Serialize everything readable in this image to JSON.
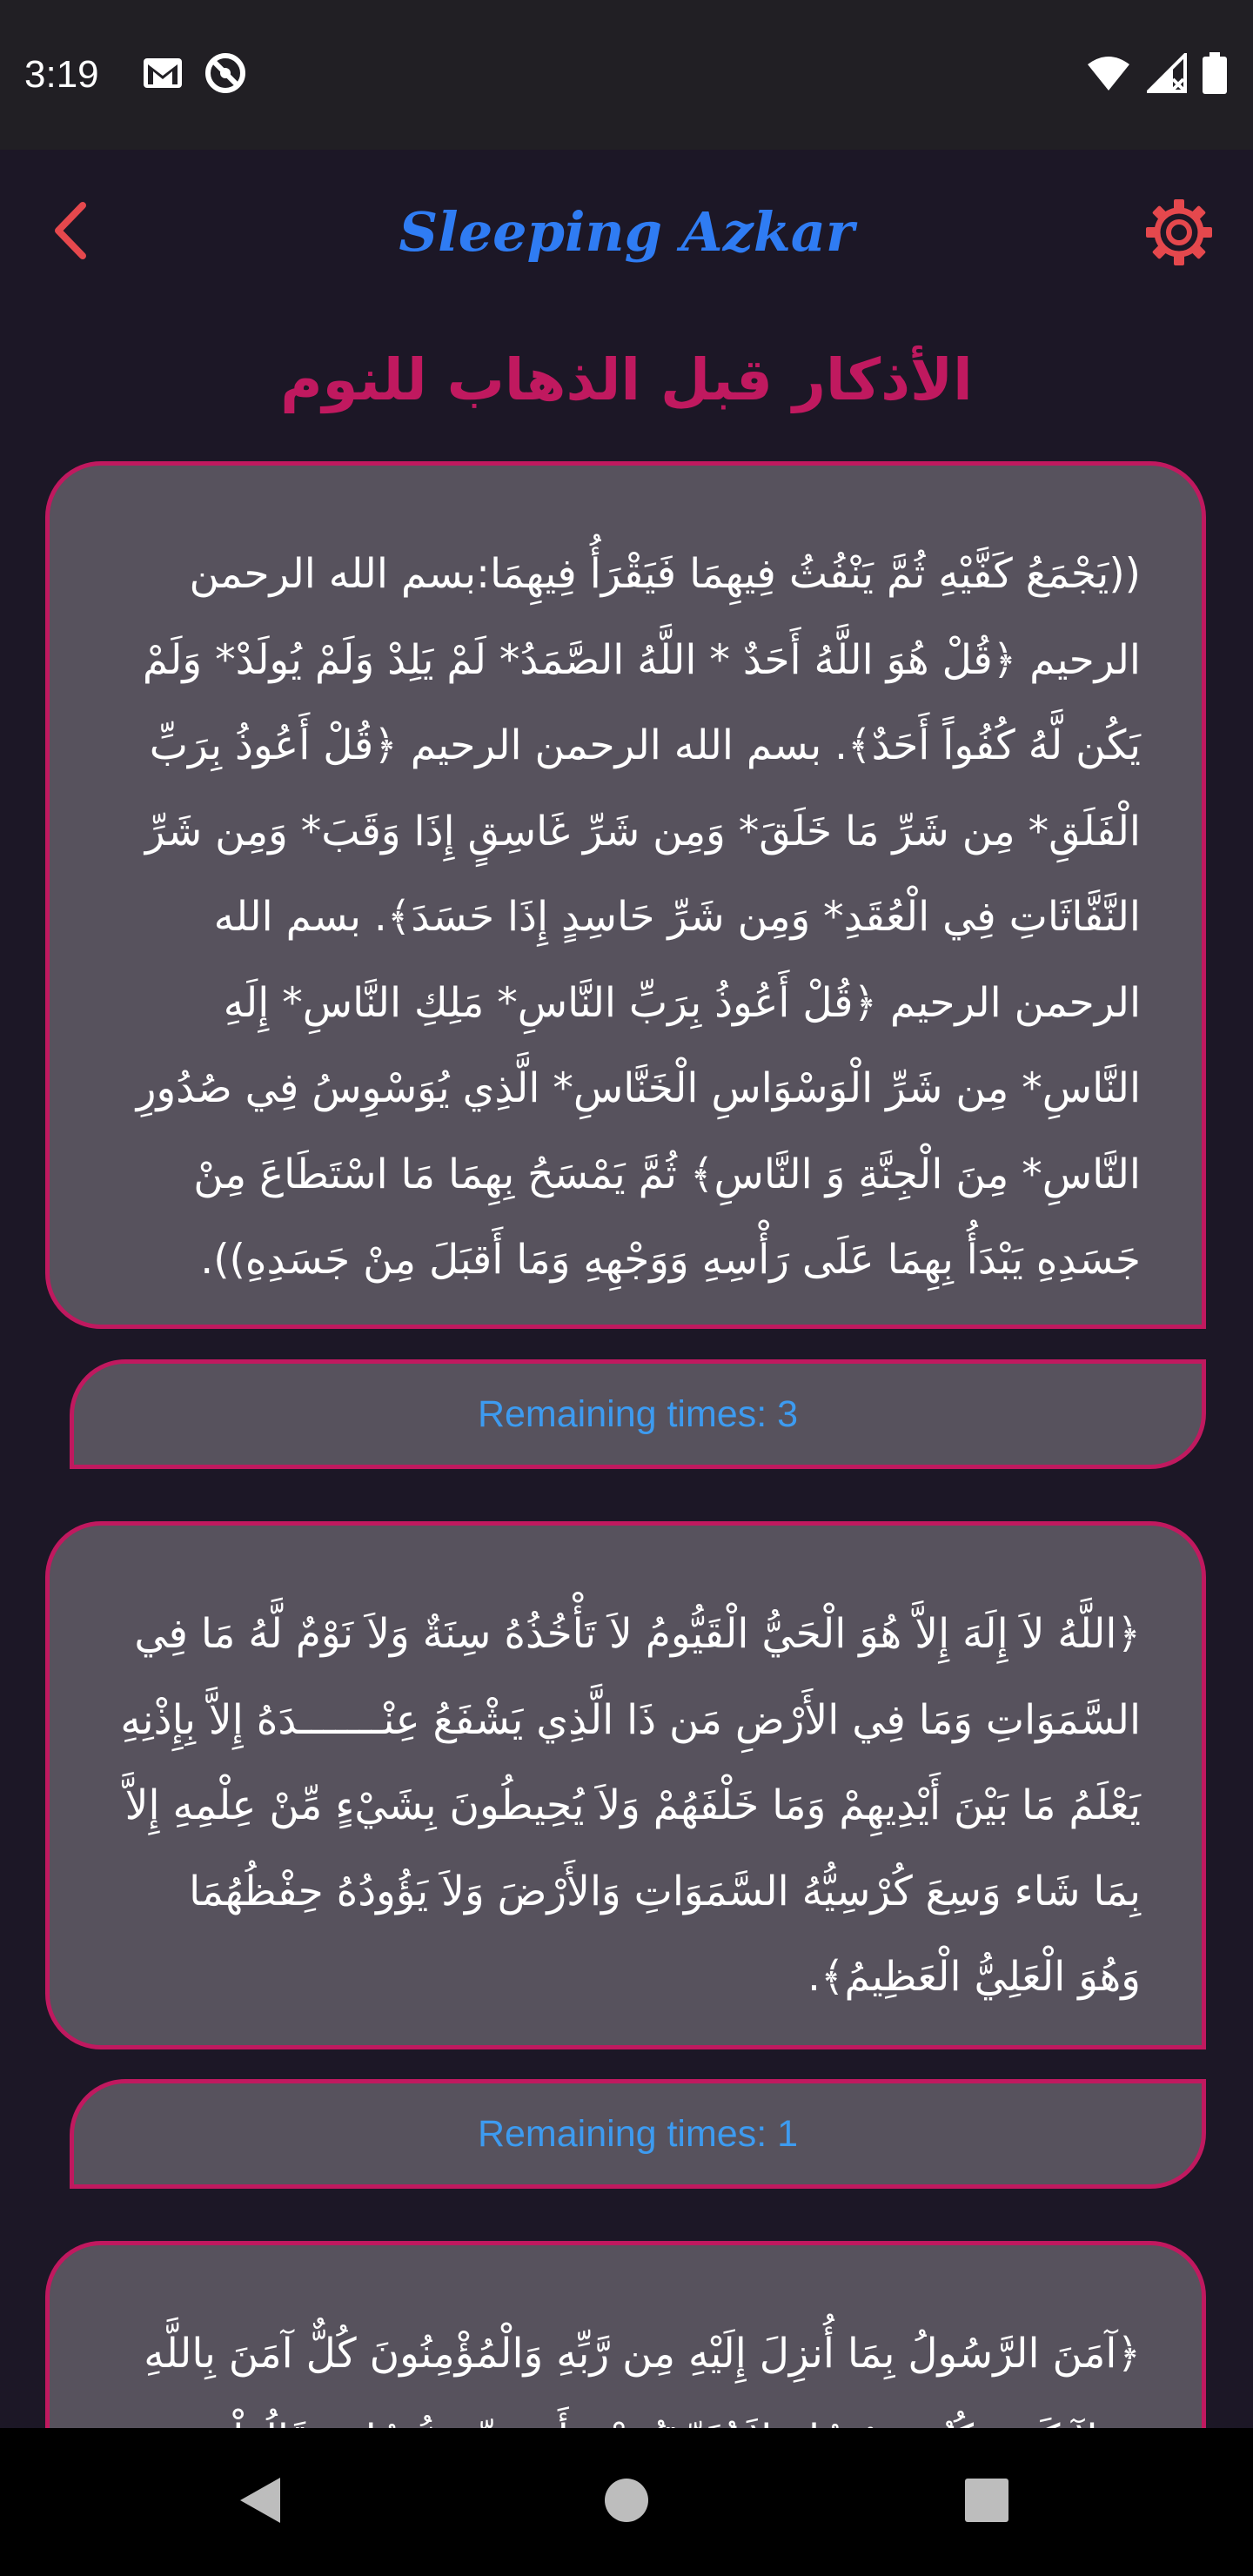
{
  "status_bar": {
    "time": "3:19",
    "icons": [
      "gmail-icon",
      "do-not-disturb-icon",
      "wifi-icon",
      "signal-icon",
      "battery-icon"
    ]
  },
  "app_bar": {
    "title": "Sleeping Azkar",
    "back_icon": "chevron-left-icon",
    "settings_icon": "gear-icon"
  },
  "page": {
    "heading": "الأذكار قبل الذهاب للنوم"
  },
  "azkar": [
    {
      "text": "((يَجْمَعُ كَفَّيْهِ ثُمَّ يَنْفُثُ فِيهِمَا فَيَقْرَأُ فِيهِمَا:بسم الله الرحمن الرحيم ﴿قُلْ هُوَ اللَّهُ أَحَدٌ * اللَّهُ الصَّمَدُ* لَمْ يَلِدْ وَلَمْ يُولَدْ* وَلَمْ يَكُن لَّهُ كُفُواً أَحَدٌ﴾. بسم الله الرحمن الرحيم ﴿قُلْ أَعُوذُ بِرَبِّ الْفَلَقِ* مِن شَرِّ مَا خَلَقَ* وَمِن شَرِّ غَاسِقٍ إِذَا وَقَبَ* وَمِن شَرِّ النَّفَّاثَاتِ فِي الْعُقَدِ* وَمِن شَرِّ حَاسِدٍ إِذَا حَسَدَ﴾. بسم الله الرحمن الرحيم ﴿قُلْ أَعُوذُ بِرَبِّ النَّاسِ* مَلِكِ النَّاسِ* إِلَهِ النَّاسِ* مِن شَرِّ الْوَسْوَاسِ الْخَنَّاسِ* الَّذِي يُوَسْوِسُ فِي صُدُورِ النَّاسِ* مِنَ الْجِنَّةِ وَ النَّاسِ﴾ ثُمَّ يَمْسَحُ بِهِمَا مَا اسْتَطَاعَ مِنْ جَسَدِهِ يَبْدَأُ بِهِمَا عَلَى رَأْسِهِ وَوَجْهِهِ وَمَا أَقبَلَ مِنْ جَسَدِهِ)).",
      "remaining_label": "Remaining times: 3"
    },
    {
      "text": "﴿اللَّهُ لاَ إِلَهَ إِلاَّ هُوَ الْحَيُّ الْقَيُّومُ لاَ تَأْخُذُهُ سِنَةٌ وَلاَ نَوْمٌ لَّهُ مَا فِي السَّمَوَاتِ وَمَا فِي الأَرْضِ مَن ذَا الَّذِي يَشْفَعُ عِنْـــــــدَهُ إِلاَّ بِإِذْنِهِ يَعْلَمُ مَا بَيْنَ أَيْدِيهِمْ وَمَا خَلْفَهُمْ وَلاَ يُحِيطُونَ بِشَيْءٍ مِّنْ عِلْمِهِ إِلاَّ بِمَا شَاء وَسِعَ كُرْسِيُّهُ السَّمَوَاتِ وَالأَرْضَ وَلاَ يَؤُودُهُ حِفْظُهُمَا وَهُوَ الْعَلِيُّ الْعَظِيمُ﴾.",
      "remaining_label": "Remaining times: 1"
    },
    {
      "text": "﴿آمَنَ الرَّسُولُ بِمَا أُنزِلَ إِلَيْهِ مِن رَّبِّهِ وَالْمُؤْمِنُونَ كُلٌّ آمَنَ بِاللَّهِ وَمَلآئِكَتِهِ وَكُتُبِهِ وَرُسُلِهِ لاَ نُفَرِّقُ بَيْنَ أَحَدٍ مِّن رُّسُلِهِ وَقَالُواْ"
    }
  ],
  "nav_bar": {
    "back_icon": "nav-back-icon",
    "home_icon": "nav-home-icon",
    "recents_icon": "nav-recents-icon"
  },
  "colors": {
    "background": "#1c1726",
    "card": "#57525d",
    "accent": "#c0195f",
    "title_blue": "#2f7cf3",
    "counter_blue": "#3d9bf0",
    "icon_red": "#e5484d"
  }
}
